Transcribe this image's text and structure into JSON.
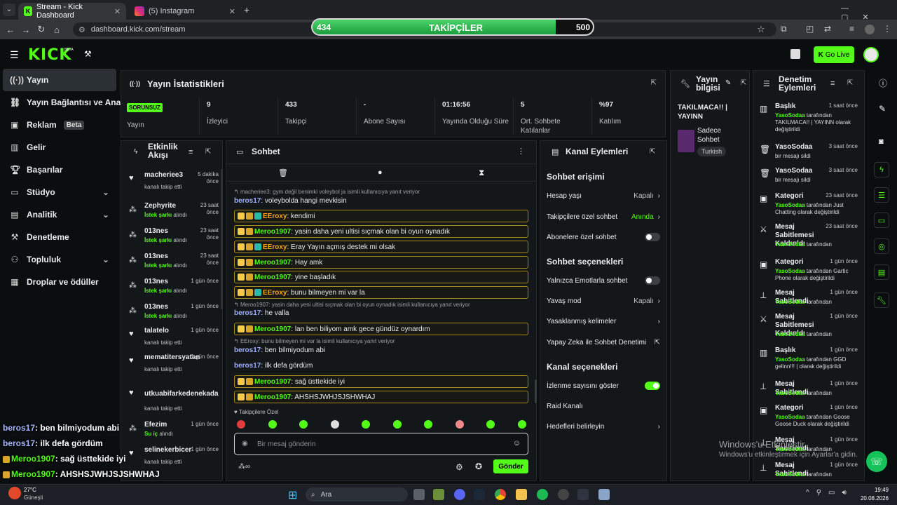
{
  "browser": {
    "tabs": [
      {
        "title": "Stream - Kick Dashboard",
        "icon": "kick-icon"
      },
      {
        "title": "(5) Instagram",
        "icon": "instagram-icon"
      }
    ],
    "url": "dashboard.kick.com/stream"
  },
  "follower_bar": {
    "current": "434",
    "label": "TAKİPÇİLER",
    "goal": "500",
    "progress": 0.868
  },
  "header": {
    "go_live": "Go Live"
  },
  "sidebar": {
    "items": [
      {
        "label": "Yayın",
        "icon": "broadcast-icon"
      },
      {
        "label": "Yayın Bağlantısı ve Anahtarı",
        "icon": "link-icon"
      },
      {
        "label": "Reklam",
        "icon": "ad-icon",
        "badge": "Beta"
      },
      {
        "label": "Gelir",
        "icon": "revenue-icon"
      },
      {
        "label": "Başarılar",
        "icon": "trophy-icon"
      },
      {
        "label": "Stüdyo",
        "icon": "studio-icon"
      },
      {
        "label": "Analitik",
        "icon": "analytics-icon"
      },
      {
        "label": "Denetleme",
        "icon": "moderation-icon"
      },
      {
        "label": "Topluluk",
        "icon": "community-icon"
      },
      {
        "label": "Droplar ve ödüller",
        "icon": "gift-icon"
      }
    ]
  },
  "stats": {
    "title": "Yayın İstatistikleri",
    "status": "SORUNSUZ",
    "status_label": "Yayın",
    "items": [
      {
        "value": "9",
        "label": "İzleyici"
      },
      {
        "value": "433",
        "label": "Takipçi"
      },
      {
        "value": "-",
        "label": "Abone Sayısı"
      },
      {
        "value": "01:16:56",
        "label": "Yayında Olduğu Süre"
      },
      {
        "value": "5",
        "label": "Ort. Sohbete Katılanlar"
      },
      {
        "value": "%97",
        "label": "Katılım"
      }
    ]
  },
  "stream_info": {
    "title": "Yayın bilgisi",
    "stream_title": "TAKILMACA!! | YAYINN",
    "category": "Sadece Sohbet",
    "tag": "Turkish"
  },
  "activity": {
    "title": "Etkinlik Akışı",
    "events": [
      {
        "user": "macheriee3",
        "sub": "kanalı takip etti",
        "time": "5 dakika önce",
        "kind": "follow"
      },
      {
        "user": "Zephyrite",
        "sub_pre": "İstek şarkı",
        "sub": "alındı",
        "time": "23 saat önce",
        "kind": "reward"
      },
      {
        "user": "013nes",
        "sub_pre": "İstek şarkı",
        "sub": "alındı",
        "time": "23 saat önce",
        "kind": "reward"
      },
      {
        "user": "013nes",
        "sub_pre": "İstek şarkı",
        "sub": "alındı",
        "time": "23 saat önce",
        "kind": "reward"
      },
      {
        "user": "013nes",
        "sub_pre": "İstek şarkı",
        "sub": "alındı",
        "time": "1 gün önce",
        "kind": "reward"
      },
      {
        "user": "013nes",
        "sub_pre": "İstek şarkı",
        "sub": "alındı",
        "time": "1 gün önce",
        "kind": "reward"
      },
      {
        "user": "talatelo",
        "sub": "kanalı takip etti",
        "time": "1 gün önce",
        "kind": "follow"
      },
      {
        "user": "mematitersyatan",
        "sub": "kanalı takip etti",
        "time": "1 gün önce",
        "kind": "follow"
      },
      {
        "user": "utkuabifarkedenekada",
        "sub": "kanalı takip etti",
        "time": "",
        "kind": "follow"
      },
      {
        "user": "Efezim",
        "sub_pre": "Su iç",
        "sub": "alındı",
        "time": "1 gün önce",
        "kind": "reward"
      },
      {
        "user": "selinekerbicer",
        "sub": "kanalı takip etti",
        "time": "1 gün önce",
        "kind": "follow"
      }
    ]
  },
  "chat": {
    "title": "Sohbet",
    "followers_only": "Takipçilere Özel",
    "placeholder": "Bir mesaj gönderin",
    "send": "Gönder",
    "messages": [
      {
        "type": "reply",
        "text": "macheriee3: gym değil benimki voleybol ja isimli kullanıcıya yanıt veriyor"
      },
      {
        "type": "plain",
        "user": "beros17",
        "text": "voleybolda hangi mevkisin"
      },
      {
        "type": "box",
        "user": "EEroxy",
        "text": "kendimi",
        "color": "#f7a51c"
      },
      {
        "type": "box",
        "user": "Meroo1907",
        "text": "yasin daha yeni ultisi sıçmak olan bi oyun oynadık",
        "color": "#53fc18"
      },
      {
        "type": "box",
        "user": "EEroxy",
        "text": "Eray Yayın açmış destek mi olsak",
        "color": "#f7a51c"
      },
      {
        "type": "box",
        "user": "Meroo1907",
        "text": "Hay amk",
        "color": "#53fc18"
      },
      {
        "type": "box",
        "user": "Meroo1907",
        "text": "yine başladık",
        "color": "#53fc18"
      },
      {
        "type": "box",
        "user": "EEroxy",
        "text": "bunu bilmeyen mi var la",
        "color": "#f7a51c"
      },
      {
        "type": "reply",
        "text": "Meroo1907: yasin daha yeni ultisi sıçmak olan bi oyun oynadık isimli kullanıcıya yanıt veriyor"
      },
      {
        "type": "plain",
        "user": "beros17",
        "text": "he valla"
      },
      {
        "type": "box",
        "user": "Meroo1907",
        "text": "lan ben biliyom amk gece gündüz oynardım",
        "color": "#53fc18"
      },
      {
        "type": "reply",
        "text": "EEroxy: bunu bilmeyen mi var la isimli kullanıcıya yanıt veriyor"
      },
      {
        "type": "plain",
        "user": "beros17",
        "text": "ben bilmiyodum abi"
      },
      {
        "type": "plain",
        "user": "beros17",
        "text": "ilk defa gördüm"
      },
      {
        "type": "box",
        "user": "Meroo1907",
        "text": "sağ üsttekide iyi",
        "color": "#53fc18"
      },
      {
        "type": "box",
        "user": "Meroo1907",
        "text": "AHSHSJWHJSJSHWHAJ",
        "color": "#53fc18"
      }
    ]
  },
  "channel_actions": {
    "title": "Kanal Eylemleri",
    "chat_access": "Sohbet erişimi",
    "rows1": [
      {
        "label": "Hesap yaşı",
        "value": "Kapalı",
        "ctl": "chevron"
      },
      {
        "label": "Takipçilere özel sohbet",
        "value": "Anında",
        "ctl": "chevron"
      },
      {
        "label": "Abonelere özel sohbet",
        "value": "",
        "ctl": "toggle-off"
      }
    ],
    "chat_options": "Sohbet seçenekleri",
    "rows2": [
      {
        "label": "Yalnızca Emotlarla sohbet",
        "value": "",
        "ctl": "toggle-off"
      },
      {
        "label": "Yavaş mod",
        "value": "Kapalı",
        "ctl": "chevron"
      },
      {
        "label": "Yasaklanmış kelimeler",
        "value": "",
        "ctl": "chevron"
      },
      {
        "label": "Yapay Zeka ile Sohbet Denetimi",
        "value": "",
        "ctl": "external"
      }
    ],
    "channel_options": "Kanal seçenekleri",
    "rows3": [
      {
        "label": "İzlenme sayısını göster",
        "value": "",
        "ctl": "toggle-on"
      },
      {
        "label": "Raid Kanalı",
        "value": "",
        "ctl": "none"
      },
      {
        "label": "Hedefleri belirleyin",
        "value": "",
        "ctl": "chevron"
      }
    ]
  },
  "mod_actions": {
    "title": "Denetim Eylemleri",
    "items": [
      {
        "title": "Başlık",
        "time": "1 saat önce",
        "who": "YasoSodaa",
        "desc": "tarafından TAKILMACA!! | YAYINN olarak değiştirildi",
        "icon": "title-icon"
      },
      {
        "title": "YasoSodaa",
        "time": "3 saat önce",
        "who": "",
        "desc": "bir mesajı sildi",
        "icon": "trash-icon"
      },
      {
        "title": "YasoSodaa",
        "time": "3 saat önce",
        "who": "",
        "desc": "bir mesajı sildi",
        "icon": "trash-icon"
      },
      {
        "title": "Kategori",
        "time": "23 saat önce",
        "who": "YasoSodaa",
        "desc": "tarafından Just Chatting olarak değiştirildi",
        "icon": "category-icon"
      },
      {
        "title": "Mesaj Sabitlemesi Kaldırıldı",
        "time": "23 saat önce",
        "who": "YasoSodaa",
        "desc": "tarafından",
        "icon": "unpin-icon"
      },
      {
        "title": "Kategori",
        "time": "1 gün önce",
        "who": "YasoSodaa",
        "desc": "tarafından Gartic Phone olarak değiştirildi",
        "icon": "category-icon"
      },
      {
        "title": "Mesaj Sabitlendi",
        "time": "1 gün önce",
        "who": "YasoSodaa",
        "desc": "tarafından",
        "icon": "pin-icon"
      },
      {
        "title": "Mesaj Sabitlemesi Kaldırıldı",
        "time": "1 gün önce",
        "who": "YasoSodaa",
        "desc": "tarafından",
        "icon": "unpin-icon"
      },
      {
        "title": "Başlık",
        "time": "1 gün önce",
        "who": "YasoSodaa",
        "desc": "tarafından GGD gelinn!!! | olarak değiştirildi",
        "icon": "title-icon"
      },
      {
        "title": "Mesaj Sabitlendi",
        "time": "1 gün önce",
        "who": "YasoSodaa",
        "desc": "tarafından",
        "icon": "pin-icon"
      },
      {
        "title": "Kategori",
        "time": "1 gün önce",
        "who": "YasoSodaa",
        "desc": "tarafından Goose Goose Duck olarak değiştirildi",
        "icon": "category-icon"
      },
      {
        "title": "Mesaj Sabitlendi",
        "time": "1 gün önce",
        "who": "YasoSodaa",
        "desc": "tarafından",
        "icon": "pin-icon"
      },
      {
        "title": "Mesaj Sabitlendi",
        "time": "1 gün önce",
        "who": "YasoSodaa",
        "desc": "tarafından",
        "icon": "pin-icon"
      }
    ]
  },
  "overlay_chat": [
    {
      "user": "beros17",
      "text": ": ben bilmiyodum abi"
    },
    {
      "user": "beros17",
      "text": ": ilk defa gördüm"
    },
    {
      "user": "Meroo1907",
      "text": ": sağ üsttekide iyi"
    },
    {
      "user": "Meroo1907",
      "text": ": AHSHSJWHJSJSHWHAJ"
    }
  ],
  "watermark": {
    "line1": "Windows'u Etkinleştir",
    "line2": "Windows'u etkinleştirmek için Ayarlar'a gidin."
  },
  "taskbar": {
    "temp": "27°C",
    "weather": "Güneşli",
    "search": "Ara",
    "time": "19:49",
    "date": "20.08.2026"
  }
}
